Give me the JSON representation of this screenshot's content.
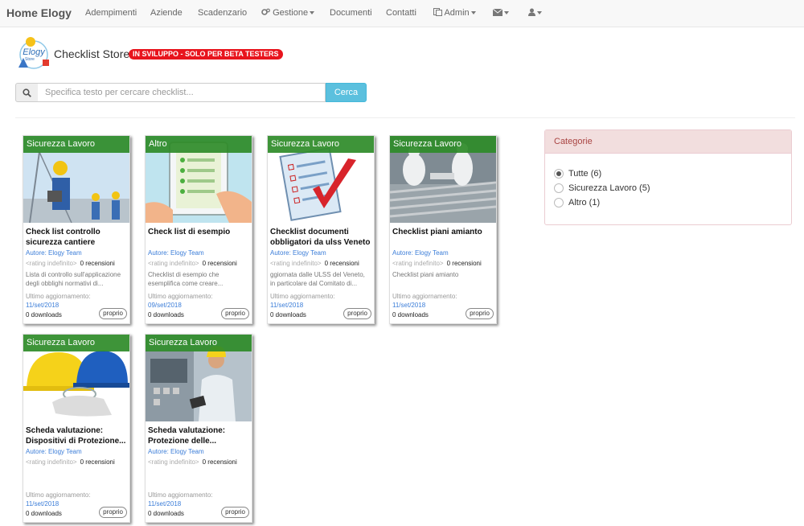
{
  "navbar": {
    "brand": "Home Elogy",
    "items": [
      {
        "label": "Adempimenti",
        "icon": ""
      },
      {
        "label": "Aziende",
        "icon": ""
      },
      {
        "label": "Scadenzario",
        "icon": ""
      },
      {
        "label": "Gestione",
        "icon": "gears-icon"
      },
      {
        "label": "Documenti",
        "icon": ""
      },
      {
        "label": "Contatti",
        "icon": ""
      },
      {
        "label": "Admin",
        "icon": "admin-icon"
      }
    ],
    "mail_icon": "envelope-icon",
    "user_icon": "user-icon"
  },
  "header": {
    "logo_text": "Elogy",
    "logo_subtext": "Store",
    "title": "Checklist Store",
    "badge": "IN SVILUPPO - SOLO PER BETA TESTERS"
  },
  "search": {
    "placeholder": "Specifica testo per cercare checklist...",
    "button": "Cerca"
  },
  "common": {
    "rating_placeholder": "<rating indefinito>",
    "updated_label": "Ultimo aggiornamento:"
  },
  "cards": [
    {
      "category": "Sicurezza Lavoro",
      "title": "Check list controllo sicurezza cantiere",
      "author": "Autore: Elogy Team",
      "reviews": "0 recensioni",
      "description": "Lista di controllo sull'applicazione degli obblighi normativi di...",
      "date": "11/set/2018",
      "downloads": "0 downloads",
      "badge": "proprio"
    },
    {
      "category": "Altro",
      "title": "Check list di esempio",
      "author": "Autore: Elogy Team",
      "reviews": "0 recensioni",
      "description": "Checklist di esempio che esemplifica come creare...",
      "date": "09/set/2018",
      "downloads": "0 downloads",
      "badge": "proprio"
    },
    {
      "category": "Sicurezza Lavoro",
      "title": "Checklist documenti obbligatori da ulss Veneto",
      "author": "Autore: Elogy Team",
      "reviews": "0 recensioni",
      "description": "ggiornata dalle ULSS del Veneto, in particolare dal Comitato di...",
      "date": "11/set/2018",
      "downloads": "0 downloads",
      "badge": "proprio"
    },
    {
      "category": "Sicurezza Lavoro",
      "title": "Checklist piani amianto",
      "author": "Autore: Elogy Team",
      "reviews": "0 recensioni",
      "description": "Checklist piani amianto",
      "date": "11/set/2018",
      "downloads": "0 downloads",
      "badge": "proprio"
    },
    {
      "category": "Sicurezza Lavoro",
      "title": "Scheda valutazione: Dispositivi di Protezione...",
      "author": "Autore: Elogy Team",
      "reviews": "0 recensioni",
      "description": "",
      "date": "11/set/2018",
      "downloads": "0 downloads",
      "badge": "proprio"
    },
    {
      "category": "Sicurezza Lavoro",
      "title": "Scheda valutazione: Protezione delle...",
      "author": "Autore: Elogy Team",
      "reviews": "0 recensioni",
      "description": "",
      "date": "11/set/2018",
      "downloads": "0 downloads",
      "badge": "proprio"
    }
  ],
  "categories": {
    "title": "Categorie",
    "options": [
      {
        "label": "Tutte (6)",
        "selected": true
      },
      {
        "label": "Sicurezza Lavoro (5)",
        "selected": false
      },
      {
        "label": "Altro (1)",
        "selected": false
      }
    ]
  },
  "colors": {
    "category_band": "#2e8b28",
    "badge_red": "#e8141d",
    "search_button": "#5bc0de",
    "link_blue": "#3b7dd8"
  }
}
